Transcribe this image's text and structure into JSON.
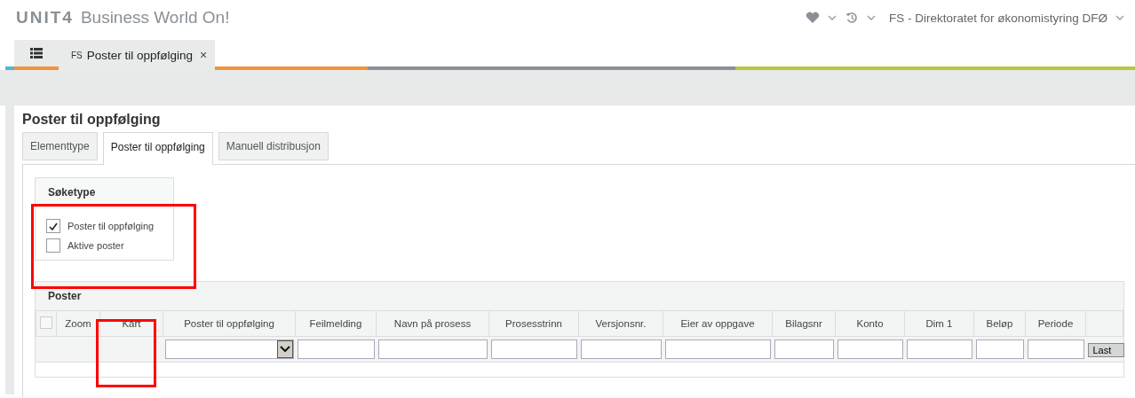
{
  "header": {
    "logo": "UNIT4",
    "product": "Business World On!",
    "company": "FS - Direktoratet for økonomistyring DFØ"
  },
  "app_tabs": [
    {
      "badge": "FS",
      "label": "Poster til oppfølging",
      "close": "×",
      "selected": true
    }
  ],
  "page_title": "Poster til oppfølging",
  "tabs": [
    {
      "label": "Elementtype",
      "selected": false
    },
    {
      "label": "Poster til oppfølging",
      "selected": true
    },
    {
      "label": "Manuell distribusjon",
      "selected": false
    }
  ],
  "search_type": {
    "title": "Søketype",
    "options": [
      {
        "label": "Poster til oppfølging",
        "checked": true
      },
      {
        "label": "Aktive poster",
        "checked": false
      }
    ]
  },
  "grid": {
    "title": "Poster",
    "select_all_checked": false,
    "columns": [
      {
        "label": "Zoom",
        "kind": "none"
      },
      {
        "label": "Kart",
        "kind": "none"
      },
      {
        "label": "Poster til oppfølging",
        "kind": "select"
      },
      {
        "label": "Feilmelding",
        "kind": "input"
      },
      {
        "label": "Navn på prosess",
        "kind": "input"
      },
      {
        "label": "Prosesstrinn",
        "kind": "input"
      },
      {
        "label": "Versjonsnr.",
        "kind": "input"
      },
      {
        "label": "Eier av oppgave",
        "kind": "input"
      },
      {
        "label": "Bilagsnr",
        "kind": "input"
      },
      {
        "label": "Konto",
        "kind": "input"
      },
      {
        "label": "Dim 1",
        "kind": "input"
      },
      {
        "label": "Beløp",
        "kind": "input"
      },
      {
        "label": "Periode",
        "kind": "input"
      }
    ],
    "load_button": "Last"
  }
}
